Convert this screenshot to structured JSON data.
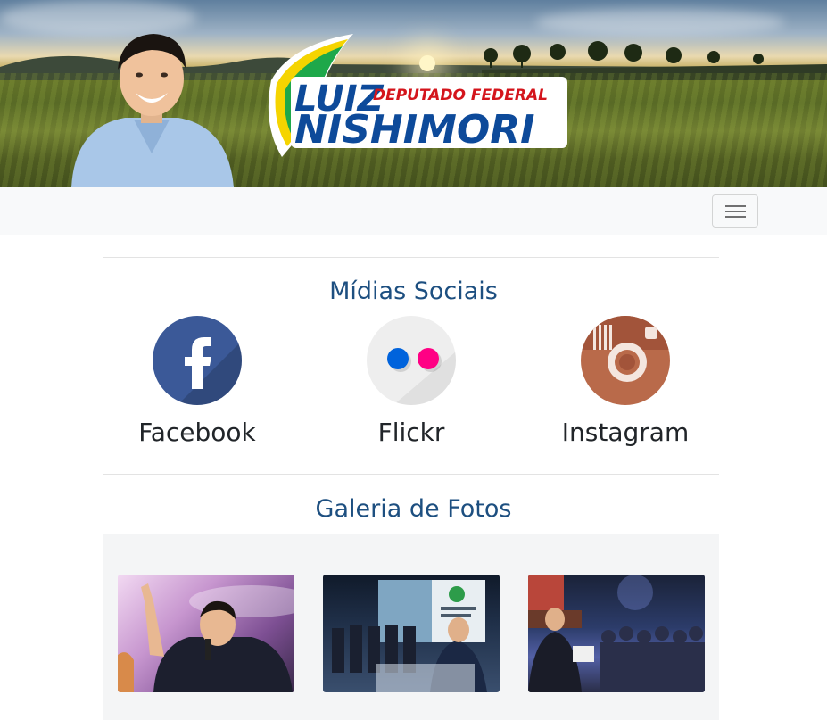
{
  "banner": {
    "logo_first_name": "LUIZ",
    "logo_subtitle": "DEPUTADO FEDERAL",
    "logo_last_name": "NISHIMORI"
  },
  "navbar": {
    "toggler_icon": "hamburger-menu-icon"
  },
  "social": {
    "title": "Mídias Sociais",
    "items": [
      {
        "label": "Facebook",
        "icon": "facebook-icon",
        "color": "#3b5998"
      },
      {
        "label": "Flickr",
        "icon": "flickr-icon",
        "color": "#eeeeee"
      },
      {
        "label": "Instagram",
        "icon": "instagram-icon",
        "color": "#b96a4a"
      }
    ]
  },
  "gallery": {
    "title": "Galeria de Fotos",
    "photos": [
      {
        "name": "gallery-photo-1"
      },
      {
        "name": "gallery-photo-2"
      },
      {
        "name": "gallery-photo-3"
      }
    ]
  }
}
